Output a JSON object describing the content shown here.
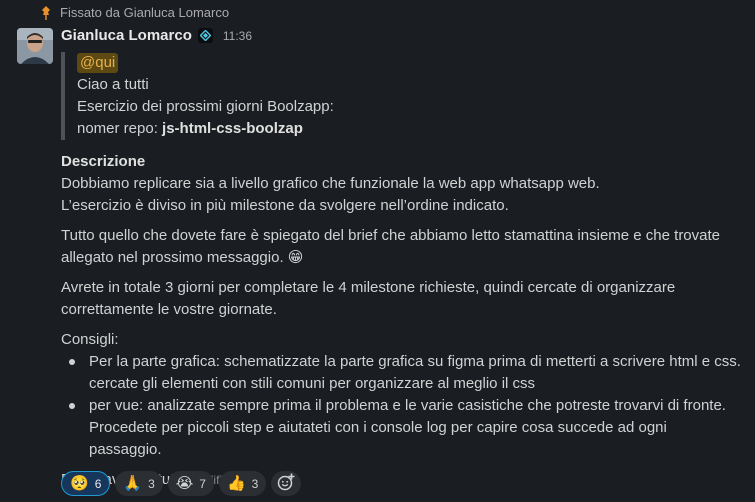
{
  "pinned": {
    "text": "Fissato da Gianluca Lomarco"
  },
  "message": {
    "author": "Gianluca Lomarco",
    "time": "11:36",
    "quote": {
      "mention": "@qui",
      "line1": "Ciao a tutti",
      "line2": "Esercizio dei prossimi giorni Boolzapp:",
      "repo_label": "nomer repo: ",
      "repo_name": "js-html-css-boolzap"
    },
    "description_title": "Descrizione",
    "description_line1": "Dobbiamo replicare sia a livello grafico che funzionale la web app whatsapp web.",
    "description_line2": "L’esercizio è diviso in più milestone da svolgere nell’ordine indicato.",
    "para2": "Tutto quello che dovete fare è spiegato del brief che abbiamo letto stamattina insieme e che trovate allegato nel prossimo messaggio.",
    "para2_emoji": "😁",
    "para3": "Avrete in totale 3 giorni per completare le 4 milestone richieste, quindi cercate di organizzare correttamente le vostre giornate.",
    "consigli_title": "Consigli:",
    "bullets": [
      "Per la parte grafica: schematizzate la parte grafica su figma prima di metterti a scrivere html e css. cercate gli elementi con stili comuni per organizzare al meglio il css",
      "per vue: analizzate sempre prima il problema e le varie casistiche che potreste trovarvi di fronte. Procedete per piccoli step e aiutateti con i console log per capire cosa succede ad ogni passaggio."
    ],
    "closing": "Buon lavoro a tutti",
    "edited": "(modificato)"
  },
  "reactions": [
    {
      "emoji": "🥺",
      "count": "6",
      "active": true
    },
    {
      "emoji": "🙏",
      "count": "3",
      "active": false
    },
    {
      "emoji": "😭",
      "count": "7",
      "active": false
    },
    {
      "emoji": "👍",
      "count": "3",
      "active": false
    }
  ],
  "colors": {
    "background": "#1a1d21",
    "mention_bg": "#5c4a12",
    "mention_text": "#e8b04b",
    "active_reaction": "#1d9bd1",
    "pin": "#e8912d"
  },
  "icons": {
    "pin": "pin-icon",
    "status": "diamond-status-icon",
    "add_reaction": "add-emoji-icon"
  }
}
